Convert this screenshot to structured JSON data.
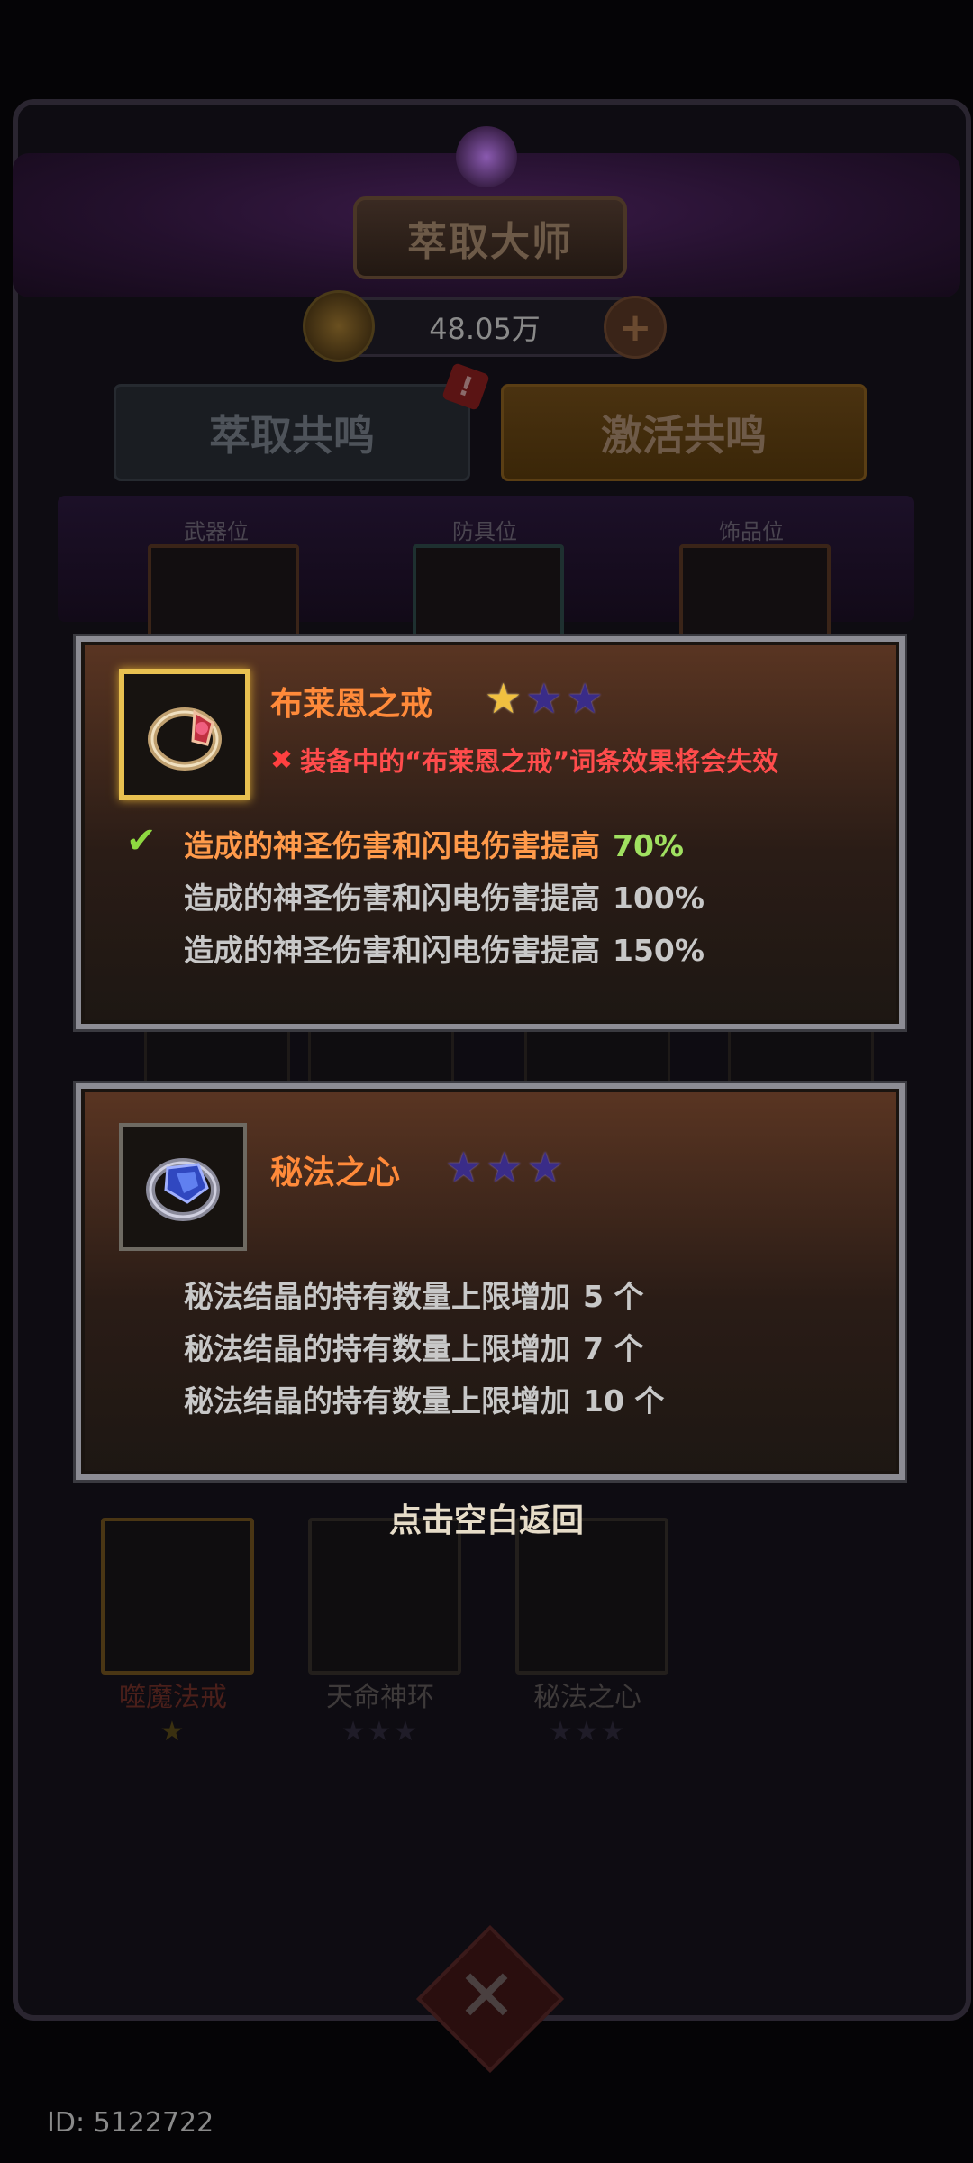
{
  "background": {
    "title": "萃取大师",
    "currency": "48.05万",
    "tabs": [
      "萃取共鸣",
      "激活共鸣"
    ],
    "slot_labels": [
      "武器位",
      "防具位",
      "饰品位"
    ],
    "items": [
      {
        "name": "噬魔法戒",
        "stars": "★"
      },
      {
        "name": "天命神环",
        "stars": "★★★"
      },
      {
        "name": "秘法之心",
        "stars": "★★★"
      }
    ]
  },
  "popup1": {
    "name": "布莱恩之戒",
    "stars_filled": 1,
    "stars_total": 3,
    "warning": "装备中的“布莱恩之戒”词条效果将会失效",
    "effects": [
      {
        "text": "造成的神圣伤害和闪电伤害提高",
        "value": "70%",
        "active": true
      },
      {
        "text": "造成的神圣伤害和闪电伤害提高",
        "value": "100%",
        "active": false
      },
      {
        "text": "造成的神圣伤害和闪电伤害提高",
        "value": "150%",
        "active": false
      }
    ]
  },
  "popup2": {
    "name": "秘法之心",
    "stars_filled": 0,
    "stars_total": 3,
    "effects": [
      {
        "text": "秘法结晶的持有数量上限增加",
        "value": "5 个"
      },
      {
        "text": "秘法结晶的持有数量上限增加",
        "value": "7 个"
      },
      {
        "text": "秘法结晶的持有数量上限增加",
        "value": "10 个"
      }
    ]
  },
  "hint": "点击空白返回",
  "footer_id": "ID: 5122722",
  "colors": {
    "name": "#ff8a3a",
    "active_value": "#a0e060",
    "warning": "#ff4c4c",
    "star_gold": "#f0c040",
    "star_empty": "#3a2c88"
  }
}
